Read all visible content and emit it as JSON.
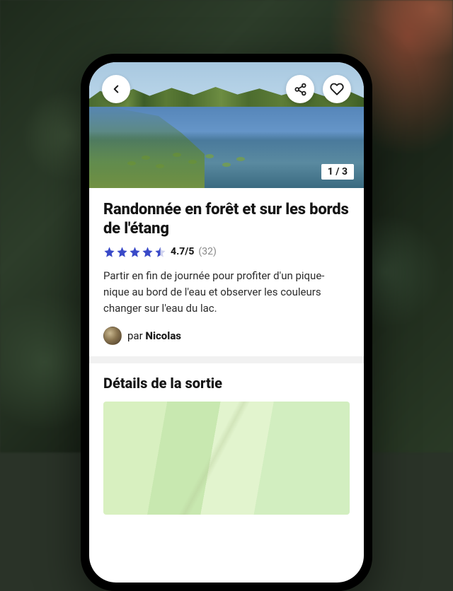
{
  "hero": {
    "image_counter": "1 / 3",
    "total_images": 3,
    "current_image": 1
  },
  "listing": {
    "title": "Randonnée en forêt et sur les bords de l'étang",
    "rating_value": "4.7/5",
    "rating_count": "(32)",
    "rating_stars": 4.5,
    "description": "Partir en fin de journée pour profiter d'un pique-nique au bord de l'eau et observer les couleurs changer sur l'eau du lac.",
    "author_prefix": "par ",
    "author_name": "Nicolas"
  },
  "details": {
    "heading": "Détails de la sortie"
  },
  "icons": {
    "back": "chevron-left",
    "share": "share",
    "favorite": "heart"
  },
  "colors": {
    "star": "#3949c8",
    "text": "#141414",
    "muted": "#888888"
  }
}
